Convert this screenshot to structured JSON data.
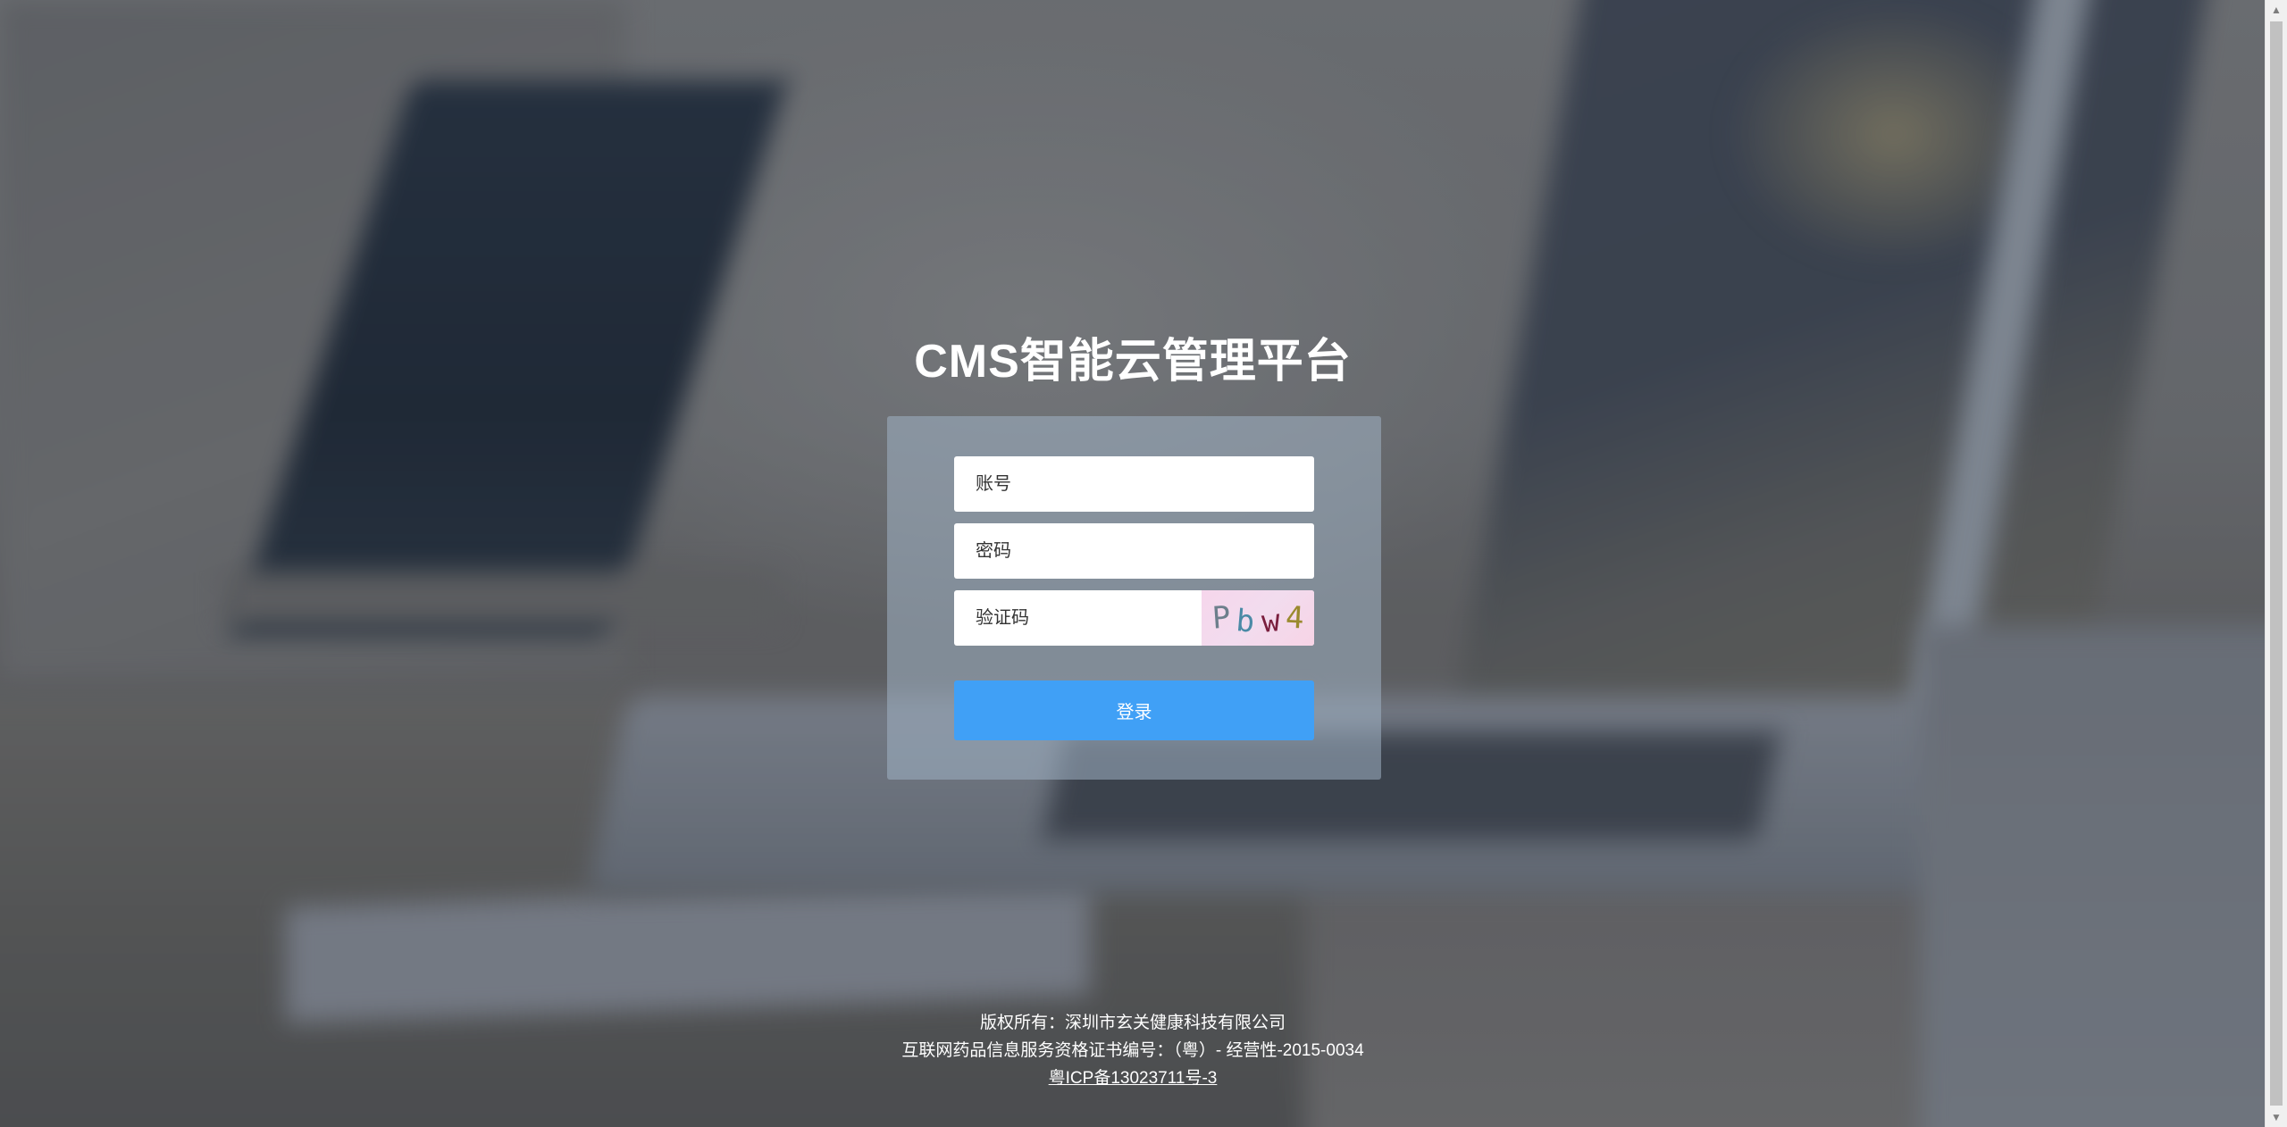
{
  "page": {
    "title": "CMS智能云管理平台"
  },
  "login": {
    "username_placeholder": "账号",
    "password_placeholder": "密码",
    "captcha_placeholder": "验证码",
    "captcha_chars": [
      "P",
      "b",
      "w",
      "4"
    ],
    "submit_label": "登录",
    "button_color": "#40a0f6"
  },
  "footer": {
    "copyright": "版权所有：深圳市玄关健康科技有限公司",
    "license": "互联网药品信息服务资格证书编号：（粤）- 经营性-2015-0034",
    "icp": "粤ICP备13023711号-3"
  },
  "icons": {
    "scroll_up": "scroll-up-arrow-icon",
    "scroll_down": "scroll-down-arrow-icon"
  }
}
